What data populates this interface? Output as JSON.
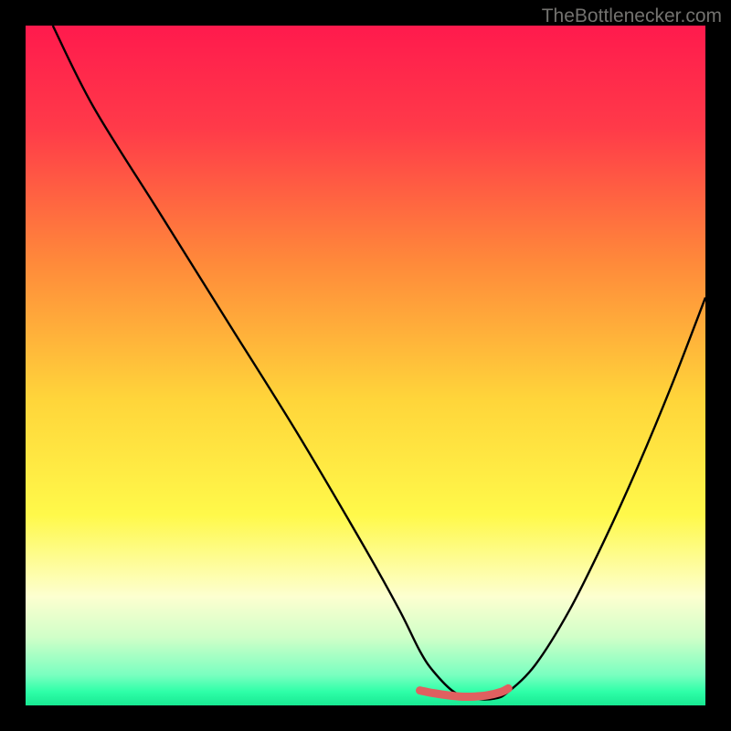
{
  "watermark": "TheBottlenecker.com",
  "chart_data": {
    "type": "line",
    "title": "",
    "xlabel": "",
    "ylabel": "",
    "xlim": [
      0,
      100
    ],
    "ylim": [
      0,
      100
    ],
    "series": [
      {
        "name": "curve",
        "x": [
          4,
          10,
          20,
          30,
          40,
          50,
          55,
          58,
          60,
          63,
          66,
          69,
          71,
          75,
          80,
          85,
          90,
          95,
          100
        ],
        "y": [
          100,
          88,
          72,
          56,
          40,
          23,
          14,
          8,
          5,
          2,
          1,
          1,
          2,
          6,
          14,
          24,
          35,
          47,
          60
        ]
      },
      {
        "name": "highlight",
        "x": [
          58,
          60,
          62,
          64,
          66,
          68,
          70,
          71
        ],
        "y": [
          2.2,
          1.8,
          1.5,
          1.3,
          1.3,
          1.5,
          2.0,
          2.5
        ]
      }
    ],
    "gradient_stops": [
      {
        "offset": 0.0,
        "color": "#ff1a4d"
      },
      {
        "offset": 0.15,
        "color": "#ff3a49"
      },
      {
        "offset": 0.35,
        "color": "#ff8a3a"
      },
      {
        "offset": 0.55,
        "color": "#ffd53a"
      },
      {
        "offset": 0.72,
        "color": "#fff94a"
      },
      {
        "offset": 0.84,
        "color": "#fdffd0"
      },
      {
        "offset": 0.9,
        "color": "#d0ffc8"
      },
      {
        "offset": 0.955,
        "color": "#7affc0"
      },
      {
        "offset": 0.98,
        "color": "#2effa8"
      },
      {
        "offset": 1.0,
        "color": "#18e892"
      }
    ],
    "highlight_color": "#e06060",
    "curve_color": "#000000"
  }
}
